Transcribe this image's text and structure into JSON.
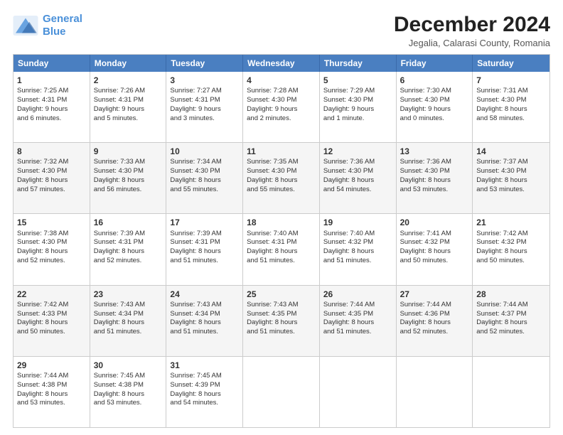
{
  "header": {
    "logo_line1": "General",
    "logo_line2": "Blue",
    "title": "December 2024",
    "subtitle": "Jegalia, Calarasi County, Romania"
  },
  "weekdays": [
    "Sunday",
    "Monday",
    "Tuesday",
    "Wednesday",
    "Thursday",
    "Friday",
    "Saturday"
  ],
  "weeks": [
    [
      {
        "day": "1",
        "lines": [
          "Sunrise: 7:25 AM",
          "Sunset: 4:31 PM",
          "Daylight: 9 hours",
          "and 6 minutes."
        ]
      },
      {
        "day": "2",
        "lines": [
          "Sunrise: 7:26 AM",
          "Sunset: 4:31 PM",
          "Daylight: 9 hours",
          "and 5 minutes."
        ]
      },
      {
        "day": "3",
        "lines": [
          "Sunrise: 7:27 AM",
          "Sunset: 4:31 PM",
          "Daylight: 9 hours",
          "and 3 minutes."
        ]
      },
      {
        "day": "4",
        "lines": [
          "Sunrise: 7:28 AM",
          "Sunset: 4:30 PM",
          "Daylight: 9 hours",
          "and 2 minutes."
        ]
      },
      {
        "day": "5",
        "lines": [
          "Sunrise: 7:29 AM",
          "Sunset: 4:30 PM",
          "Daylight: 9 hours",
          "and 1 minute."
        ]
      },
      {
        "day": "6",
        "lines": [
          "Sunrise: 7:30 AM",
          "Sunset: 4:30 PM",
          "Daylight: 9 hours",
          "and 0 minutes."
        ]
      },
      {
        "day": "7",
        "lines": [
          "Sunrise: 7:31 AM",
          "Sunset: 4:30 PM",
          "Daylight: 8 hours",
          "and 58 minutes."
        ]
      }
    ],
    [
      {
        "day": "8",
        "lines": [
          "Sunrise: 7:32 AM",
          "Sunset: 4:30 PM",
          "Daylight: 8 hours",
          "and 57 minutes."
        ]
      },
      {
        "day": "9",
        "lines": [
          "Sunrise: 7:33 AM",
          "Sunset: 4:30 PM",
          "Daylight: 8 hours",
          "and 56 minutes."
        ]
      },
      {
        "day": "10",
        "lines": [
          "Sunrise: 7:34 AM",
          "Sunset: 4:30 PM",
          "Daylight: 8 hours",
          "and 55 minutes."
        ]
      },
      {
        "day": "11",
        "lines": [
          "Sunrise: 7:35 AM",
          "Sunset: 4:30 PM",
          "Daylight: 8 hours",
          "and 55 minutes."
        ]
      },
      {
        "day": "12",
        "lines": [
          "Sunrise: 7:36 AM",
          "Sunset: 4:30 PM",
          "Daylight: 8 hours",
          "and 54 minutes."
        ]
      },
      {
        "day": "13",
        "lines": [
          "Sunrise: 7:36 AM",
          "Sunset: 4:30 PM",
          "Daylight: 8 hours",
          "and 53 minutes."
        ]
      },
      {
        "day": "14",
        "lines": [
          "Sunrise: 7:37 AM",
          "Sunset: 4:30 PM",
          "Daylight: 8 hours",
          "and 53 minutes."
        ]
      }
    ],
    [
      {
        "day": "15",
        "lines": [
          "Sunrise: 7:38 AM",
          "Sunset: 4:30 PM",
          "Daylight: 8 hours",
          "and 52 minutes."
        ]
      },
      {
        "day": "16",
        "lines": [
          "Sunrise: 7:39 AM",
          "Sunset: 4:31 PM",
          "Daylight: 8 hours",
          "and 52 minutes."
        ]
      },
      {
        "day": "17",
        "lines": [
          "Sunrise: 7:39 AM",
          "Sunset: 4:31 PM",
          "Daylight: 8 hours",
          "and 51 minutes."
        ]
      },
      {
        "day": "18",
        "lines": [
          "Sunrise: 7:40 AM",
          "Sunset: 4:31 PM",
          "Daylight: 8 hours",
          "and 51 minutes."
        ]
      },
      {
        "day": "19",
        "lines": [
          "Sunrise: 7:40 AM",
          "Sunset: 4:32 PM",
          "Daylight: 8 hours",
          "and 51 minutes."
        ]
      },
      {
        "day": "20",
        "lines": [
          "Sunrise: 7:41 AM",
          "Sunset: 4:32 PM",
          "Daylight: 8 hours",
          "and 50 minutes."
        ]
      },
      {
        "day": "21",
        "lines": [
          "Sunrise: 7:42 AM",
          "Sunset: 4:32 PM",
          "Daylight: 8 hours",
          "and 50 minutes."
        ]
      }
    ],
    [
      {
        "day": "22",
        "lines": [
          "Sunrise: 7:42 AM",
          "Sunset: 4:33 PM",
          "Daylight: 8 hours",
          "and 50 minutes."
        ]
      },
      {
        "day": "23",
        "lines": [
          "Sunrise: 7:43 AM",
          "Sunset: 4:34 PM",
          "Daylight: 8 hours",
          "and 51 minutes."
        ]
      },
      {
        "day": "24",
        "lines": [
          "Sunrise: 7:43 AM",
          "Sunset: 4:34 PM",
          "Daylight: 8 hours",
          "and 51 minutes."
        ]
      },
      {
        "day": "25",
        "lines": [
          "Sunrise: 7:43 AM",
          "Sunset: 4:35 PM",
          "Daylight: 8 hours",
          "and 51 minutes."
        ]
      },
      {
        "day": "26",
        "lines": [
          "Sunrise: 7:44 AM",
          "Sunset: 4:35 PM",
          "Daylight: 8 hours",
          "and 51 minutes."
        ]
      },
      {
        "day": "27",
        "lines": [
          "Sunrise: 7:44 AM",
          "Sunset: 4:36 PM",
          "Daylight: 8 hours",
          "and 52 minutes."
        ]
      },
      {
        "day": "28",
        "lines": [
          "Sunrise: 7:44 AM",
          "Sunset: 4:37 PM",
          "Daylight: 8 hours",
          "and 52 minutes."
        ]
      }
    ],
    [
      {
        "day": "29",
        "lines": [
          "Sunrise: 7:44 AM",
          "Sunset: 4:38 PM",
          "Daylight: 8 hours",
          "and 53 minutes."
        ]
      },
      {
        "day": "30",
        "lines": [
          "Sunrise: 7:45 AM",
          "Sunset: 4:38 PM",
          "Daylight: 8 hours",
          "and 53 minutes."
        ]
      },
      {
        "day": "31",
        "lines": [
          "Sunrise: 7:45 AM",
          "Sunset: 4:39 PM",
          "Daylight: 8 hours",
          "and 54 minutes."
        ]
      },
      null,
      null,
      null,
      null
    ]
  ]
}
